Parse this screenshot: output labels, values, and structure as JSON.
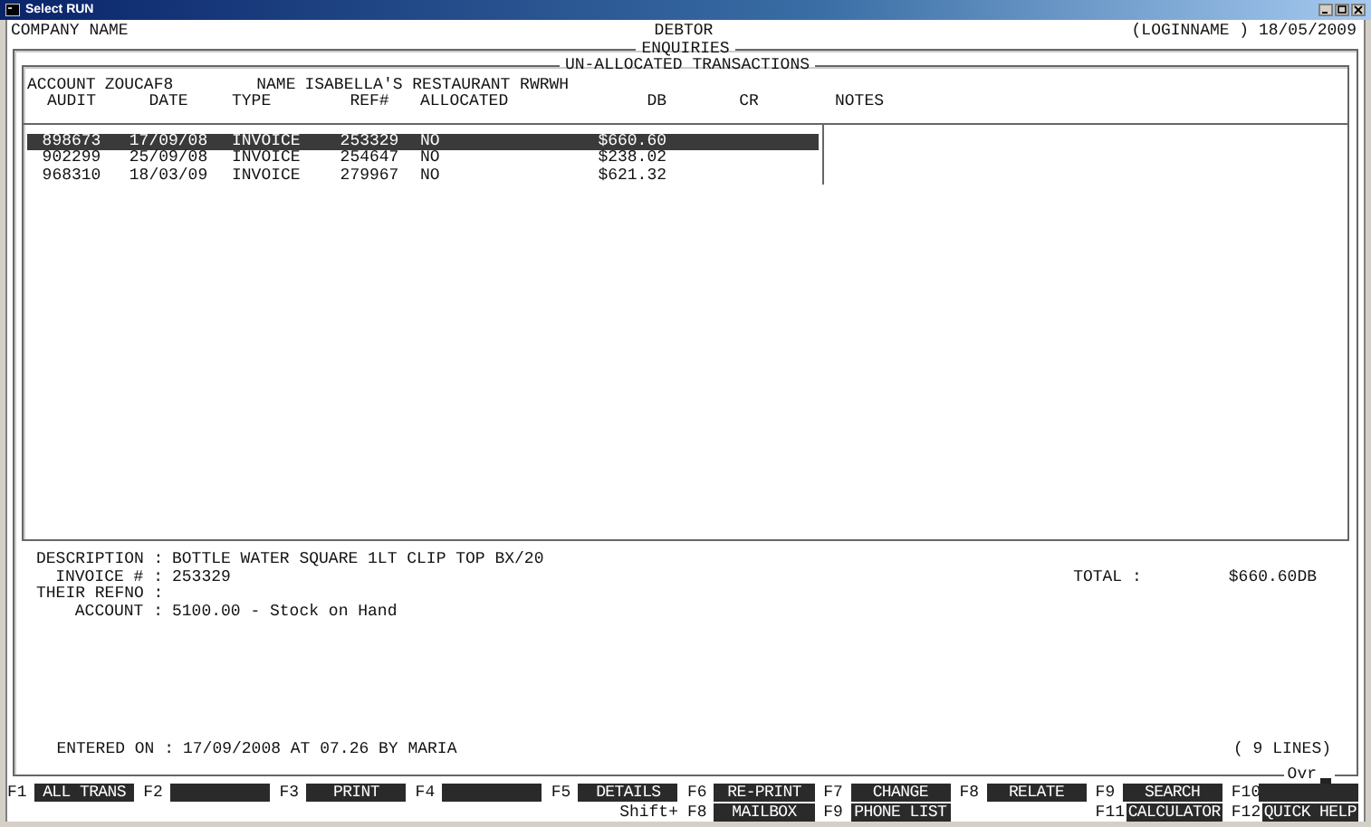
{
  "window": {
    "title": "Select RUN"
  },
  "header": {
    "company": "COMPANY NAME",
    "module": "DEBTOR",
    "user_date": "(LOGINNAME ) 18/05/2009",
    "screen": "ENQUIRIES"
  },
  "panel": {
    "title": "UN-ALLOCATED TRANSACTIONS",
    "account_label": "ACCOUNT",
    "account": "ZOUCAF8",
    "name_label": "NAME",
    "name": "ISABELLA'S RESTAURANT RWRWH"
  },
  "table": {
    "columns": [
      "AUDIT",
      "DATE",
      "TYPE",
      "REF#",
      "ALLOCATED",
      "DB",
      "CR",
      "NOTES"
    ],
    "rows": [
      {
        "audit": "898673",
        "date": "17/09/08",
        "type": "INVOICE",
        "ref": "253329",
        "allocated": "NO",
        "db": "$660.60",
        "selected": true
      },
      {
        "audit": "902299",
        "date": "25/09/08",
        "type": "INVOICE",
        "ref": "254647",
        "allocated": "NO",
        "db": "$238.02",
        "selected": false
      },
      {
        "audit": "968310",
        "date": "18/03/09",
        "type": "INVOICE",
        "ref": "279967",
        "allocated": "NO",
        "db": "$621.32",
        "selected": false
      }
    ]
  },
  "details": {
    "fields": [
      {
        "label": "DESCRIPTION :",
        "value": "BOTTLE WATER SQUARE 1LT CLIP TOP BX/20"
      },
      {
        "label": "INVOICE # :",
        "value": "253329"
      },
      {
        "label": "THEIR REFNO :"
      },
      {
        "label": "ACCOUNT :",
        "value": "5100.00 - Stock on Hand"
      }
    ],
    "total_label": "TOTAL :",
    "total": "$660.60DB",
    "entered_label": "ENTERED ON :",
    "entered": "17/09/2008 AT 07.26 BY MARIA",
    "lines": "(  9 LINES)"
  },
  "status": "Ovr",
  "function_keys": [
    {
      "key": "F1",
      "label": "ALL TRANS"
    },
    {
      "key": "F2"
    },
    {
      "key": "F3",
      "label": "PRINT"
    },
    {
      "key": "F4"
    },
    {
      "key": "F5",
      "label": "DETAILS",
      "lower": {
        "kind": "note",
        "text": "Shift+"
      }
    },
    {
      "key": "F6",
      "label": "RE-PRINT",
      "lower": {
        "kind": "key",
        "key": "F8",
        "label": "MAILBOX"
      }
    },
    {
      "key": "F7",
      "label": "CHANGE",
      "lower": {
        "kind": "key",
        "key": "F9",
        "label": "PHONE LIST"
      }
    },
    {
      "key": "F8",
      "label": "RELATE"
    },
    {
      "key": "F9",
      "label": "SEARCH",
      "lower": {
        "kind": "key",
        "key": "F11",
        "label": "CALCULATOR"
      }
    },
    {
      "key": "F10",
      "lower": {
        "kind": "key",
        "key": "F12",
        "label": "QUICK HELP"
      }
    }
  ]
}
